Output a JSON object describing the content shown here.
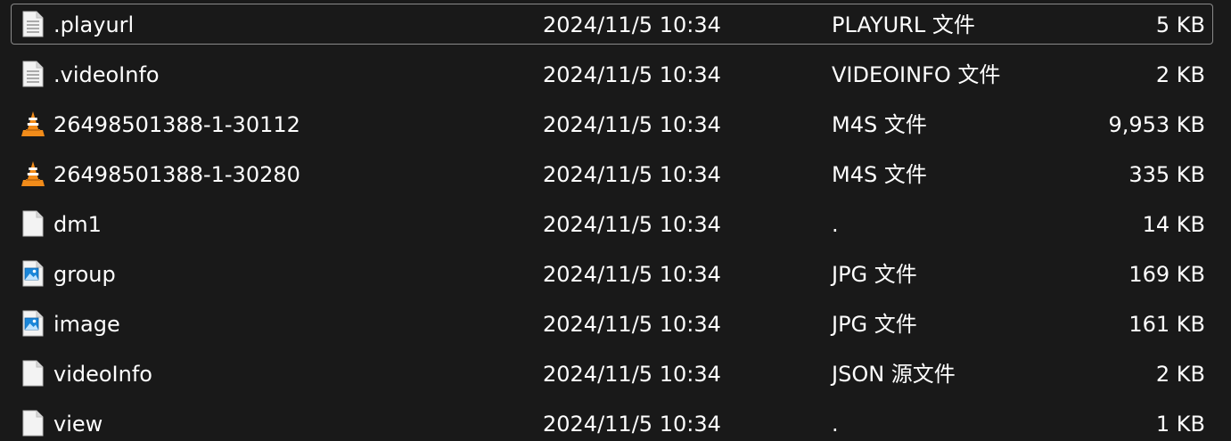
{
  "files": [
    {
      "icon": "text-file-icon",
      "name": ".playurl",
      "modified": "2024/11/5 10:34",
      "type": "PLAYURL 文件",
      "size": "5 KB",
      "selected": true
    },
    {
      "icon": "text-file-icon",
      "name": ".videoInfo",
      "modified": "2024/11/5 10:34",
      "type": "VIDEOINFO 文件",
      "size": "2 KB"
    },
    {
      "icon": "vlc-media-icon",
      "name": "26498501388-1-30112",
      "modified": "2024/11/5 10:34",
      "type": "M4S 文件",
      "size": "9,953 KB"
    },
    {
      "icon": "vlc-media-icon",
      "name": "26498501388-1-30280",
      "modified": "2024/11/5 10:34",
      "type": "M4S 文件",
      "size": "335 KB"
    },
    {
      "icon": "blank-file-icon",
      "name": "dm1",
      "modified": "2024/11/5 10:34",
      "type": ".",
      "size": "14 KB"
    },
    {
      "icon": "image-file-icon",
      "name": "group",
      "modified": "2024/11/5 10:34",
      "type": "JPG 文件",
      "size": "169 KB"
    },
    {
      "icon": "image-file-icon",
      "name": "image",
      "modified": "2024/11/5 10:34",
      "type": "JPG 文件",
      "size": "161 KB"
    },
    {
      "icon": "blank-file-icon",
      "name": "videoInfo",
      "modified": "2024/11/5 10:34",
      "type": "JSON 源文件",
      "size": "2 KB"
    },
    {
      "icon": "blank-file-icon",
      "name": "view",
      "modified": "2024/11/5 10:34",
      "type": ".",
      "size": "1 KB"
    }
  ],
  "colors": {
    "background": "#191919",
    "text": "#ffffff",
    "selection_border": "#8a8a8a",
    "vlc_orange": "#f28c1a"
  }
}
